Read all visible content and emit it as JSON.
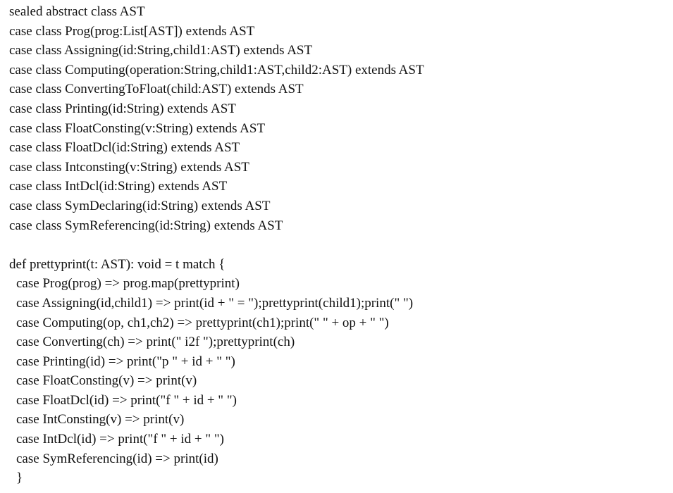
{
  "class_definitions": [
    "sealed abstract class AST",
    "case class Prog(prog:List[AST]) extends AST",
    "case class Assigning(id:String,child1:AST) extends AST",
    "case class Computing(operation:String,child1:AST,child2:AST) extends AST",
    "case class ConvertingToFloat(child:AST) extends AST",
    "case class Printing(id:String) extends AST",
    "case class FloatConsting(v:String) extends AST",
    "case class FloatDcl(id:String) extends AST",
    "case class Intconsting(v:String) extends AST",
    "case class IntDcl(id:String) extends AST",
    "case class SymDeclaring(id:String) extends AST",
    "case class SymReferencing(id:String) extends AST"
  ],
  "function_header": "def prettyprint(t: AST): void = t match {",
  "match_cases": [
    "case Prog(prog) => prog.map(prettyprint)",
    "case Assigning(id,child1) => print(id + \" = \");prettyprint(child1);print(\" \")",
    "case Computing(op, ch1,ch2) => prettyprint(ch1);print(\" \" + op + \" \")",
    "case Converting(ch) => print(\" i2f \");prettyprint(ch)",
    "case Printing(id) => print(\"p \" + id + \" \")",
    "case FloatConsting(v) => print(v)",
    "case FloatDcl(id) => print(\"f \" + id + \" \")",
    "case IntConsting(v) => print(v)",
    "case IntDcl(id) => print(\"f \" + id + \" \")",
    "case SymReferencing(id) => print(id)"
  ],
  "closing_brace": "}"
}
